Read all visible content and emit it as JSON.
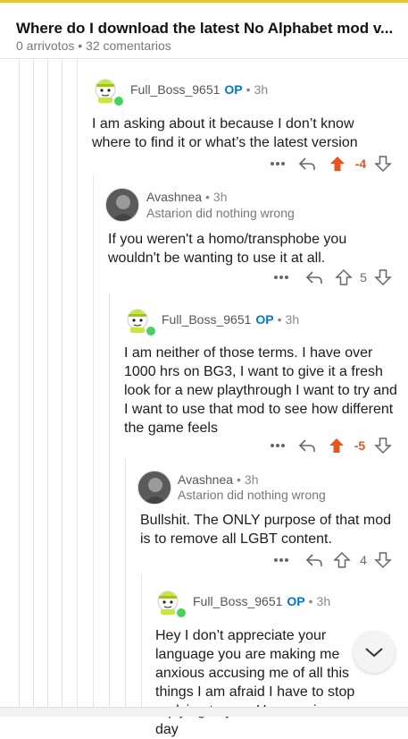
{
  "post": {
    "title": "Where do I download the latest No Alphabet mod v...",
    "upvotes": "0 arrivotos",
    "separator": "•",
    "comments": "32 comentarios"
  },
  "comments": [
    {
      "user": "Full_Boss_9651",
      "op": "OP",
      "age": "3h",
      "body": "I am asking about it because I don’t know where to find it or what’s the latest version",
      "score": "-4"
    },
    {
      "user": "Avashnea",
      "age": "3h",
      "flair": "Astarion did nothing wrong",
      "body": "If you weren't a homo/transphobe you wouldn't be wanting to use it at all.",
      "score": "5"
    },
    {
      "user": "Full_Boss_9651",
      "op": "OP",
      "age": "3h",
      "body": "I am neither of those terms. I have over 1000 hrs on BG3, I want to give it a fresh look for a new playthrough I want to try and I want to use that mod to see how different the game feels",
      "score": "-5"
    },
    {
      "user": "Avashnea",
      "age": "3h",
      "flair": "Astarion did nothing wrong",
      "body": "Bullshit. The ONLY purpose of that mod is to remove all LGBT content.",
      "score": "4"
    },
    {
      "user": "Full_Boss_9651",
      "op": "OP",
      "age": "3h",
      "body": "Hey I don’t appreciate your language you are making me anxious accusing me of all this things I am afraid I have to stop replying to you. Have a nice day"
    }
  ],
  "icons": {
    "more": "more-icon",
    "reply": "reply-icon",
    "upvote": "upvote-icon",
    "downvote": "downvote-icon",
    "scroll_down": "chevron-down-icon"
  },
  "colors": {
    "op": "#0079d3",
    "downvoted": "#e8541d",
    "online": "#46d160",
    "accent_top": "#e8c33a"
  }
}
